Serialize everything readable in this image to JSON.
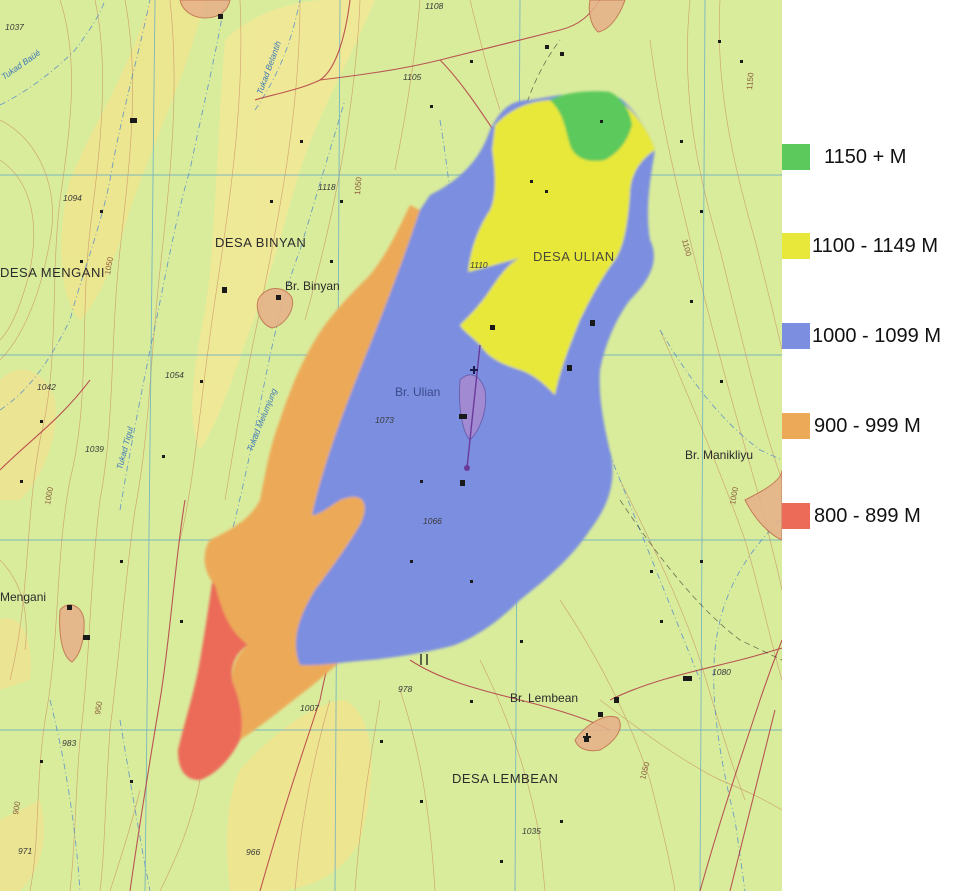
{
  "legend": {
    "items": [
      {
        "label": "1150 + M",
        "color": "#5cc95c"
      },
      {
        "label": "1100 - 1149 M",
        "color": "#e8e83a"
      },
      {
        "label": "1000 - 1099 M",
        "color": "#7b8ee0"
      },
      {
        "label": "900 - 999 M",
        "color": "#ecaa58"
      },
      {
        "label": "800 - 899 M",
        "color": "#ec6a58"
      }
    ]
  },
  "map": {
    "places": {
      "desa_binyan": "DESA BINYAN",
      "br_binyan": "Br. Binyan",
      "desa_mengani": "DESA MENGANI",
      "mengani": "Mengani",
      "desa_ulian": "DESA ULIAN",
      "br_ulian": "Br. Ulian",
      "br_manikliyu": "Br. Manikliyu",
      "br_lembean": "Br. Lembean",
      "desa_lembean": "DESA LEMBEAN"
    },
    "streams": {
      "tukad_bau": "Tukad Baüé",
      "tukad_belantih": "Tukad Belantih",
      "tukad_melumjung": "Tukad Melumjung",
      "tukad_tigul": "Tukad Tigul"
    },
    "spot_heights": {
      "h1037": "1037",
      "h1108": "1108",
      "h1105": "1105",
      "h1094": "1094",
      "h1118": "1118",
      "h1110": "1110",
      "h1054": "1054",
      "h1042": "1042",
      "h1039": "1039",
      "h1073": "1073",
      "h1066": "1066",
      "h1080": "1080",
      "h1007": "1007",
      "h978": "978",
      "h983": "983",
      "h971": "971",
      "h966": "966",
      "h1035": "1035"
    },
    "contour_labels": {
      "c1050a": "1050",
      "c1000a": "1000",
      "c1150": "1150",
      "c1100": "1100",
      "c1050b": "1050",
      "c1000b": "1000",
      "c950a": "950",
      "c900": "900",
      "c1050c": "1050"
    },
    "colors": {
      "background": "#d9ec9c",
      "grid": "#5aa6c8",
      "contour": "#c88c60",
      "road": "#b03040",
      "stream": "#5a8fc8"
    }
  }
}
